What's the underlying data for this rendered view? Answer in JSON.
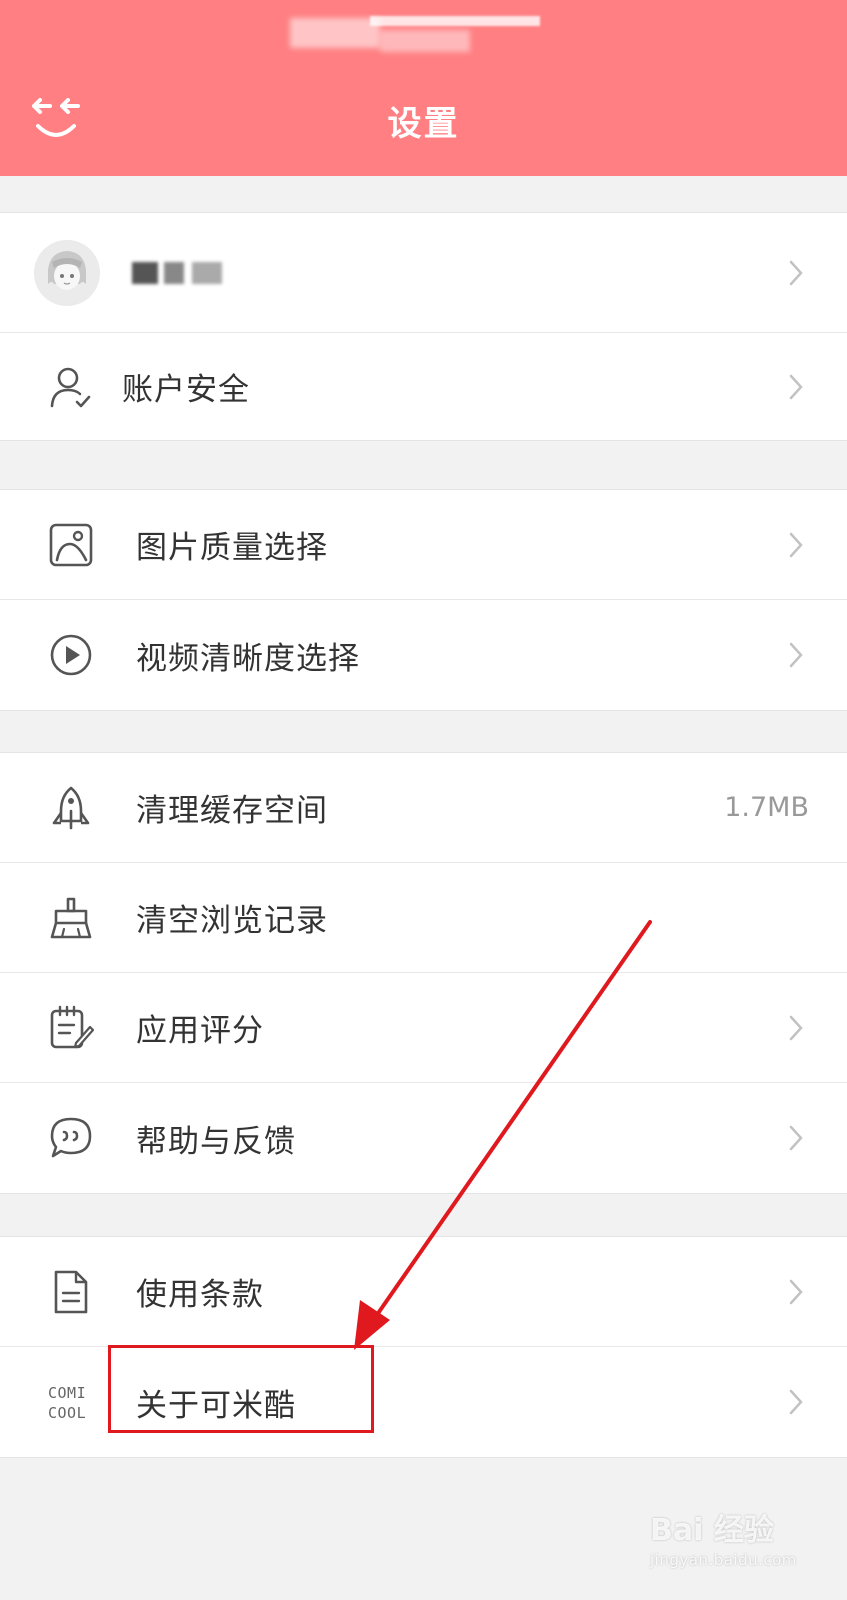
{
  "header": {
    "title": "设置",
    "background_color": "#ff7f82",
    "back_icon": "smile-back-icon"
  },
  "profile": {
    "avatar": "avatar-anime-girl",
    "username": "(blurred)"
  },
  "groups": [
    [
      {
        "icon": "user-shield-icon",
        "label": "账户安全",
        "chevron": true
      }
    ],
    [
      {
        "icon": "image-icon",
        "label": "图片质量选择",
        "chevron": true
      },
      {
        "icon": "play-circle-icon",
        "label": "视频清晰度选择",
        "chevron": true
      }
    ],
    [
      {
        "icon": "rocket-icon",
        "label": "清理缓存空间",
        "value": "1.7MB"
      },
      {
        "icon": "broom-icon",
        "label": "清空浏览记录"
      },
      {
        "icon": "notepad-pen-icon",
        "label": "应用评分",
        "chevron": true
      },
      {
        "icon": "chat-bubble-icon",
        "label": "帮助与反馈",
        "chevron": true
      }
    ],
    [
      {
        "icon": "document-icon",
        "label": "使用条款",
        "chevron": true
      },
      {
        "icon": "comicool-logo-icon",
        "label": "关于可米酷",
        "chevron": true
      }
    ]
  ],
  "annotation": {
    "highlight_color": "#e0191f",
    "highlight_target": "关于可米酷"
  },
  "watermark": {
    "main": "Bai 经验",
    "sub": "jingyan.baidu.com"
  }
}
